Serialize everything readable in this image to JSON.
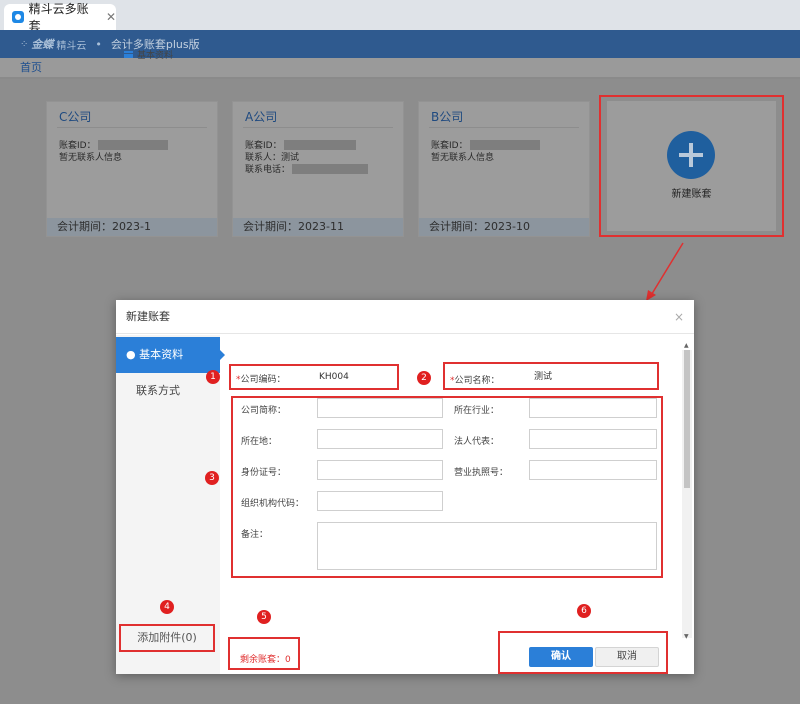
{
  "browser_tab": {
    "title": "精斗云多账套",
    "close": "✕"
  },
  "appbar": {
    "logo": "金蝶",
    "logo_sub": "精斗云",
    "separator": "•",
    "app_name": "会计多账套plus版"
  },
  "nav": {
    "home": "首页"
  },
  "cards": [
    {
      "name": "C公司",
      "rows": [
        {
          "label": "账套ID：",
          "masked": true
        },
        {
          "label": "暂无联系人信息"
        }
      ],
      "period": "会计期间：2023-1"
    },
    {
      "name": "A公司",
      "rows": [
        {
          "label": "账套ID：",
          "masked": true
        },
        {
          "label": "联系人：测试"
        },
        {
          "label": "联系电话：",
          "masked": true
        }
      ],
      "period": "会计期间：2023-11"
    },
    {
      "name": "B公司",
      "rows": [
        {
          "label": "账套ID：",
          "masked": true
        },
        {
          "label": "暂无联系人信息"
        }
      ],
      "period": "会计期间：2023-10"
    }
  ],
  "new_card": {
    "label": "新建账套"
  },
  "modal": {
    "title": "新建账套",
    "close": "×",
    "sidebar": {
      "basic": "● 基本资料",
      "contact": "联系方式"
    },
    "section_title": "基本资料",
    "fields": {
      "code": {
        "label": "公司编码：",
        "required": "*",
        "value": "KH004"
      },
      "name": {
        "label": "公司名称：",
        "required": "*",
        "value": "测试"
      },
      "short_name": {
        "label": "公司简称：",
        "value": ""
      },
      "industry": {
        "label": "所在行业：",
        "value": ""
      },
      "location": {
        "label": "所在地：",
        "value": ""
      },
      "legal_rep": {
        "label": "法人代表：",
        "value": ""
      },
      "id_number": {
        "label": "身份证号：",
        "value": ""
      },
      "license": {
        "label": "营业执照号：",
        "value": ""
      },
      "org_code": {
        "label": "组织机构代码：",
        "value": ""
      },
      "remark": {
        "label": "备注：",
        "value": ""
      }
    },
    "attach_button": "添加附件(0)",
    "remaining": "剩余账套：0",
    "confirm_button": "确认",
    "cancel_button": "取消"
  },
  "badges": [
    "1",
    "2",
    "3",
    "4",
    "5",
    "6"
  ],
  "colors": {
    "accent": "#2b7fd8",
    "annotation": "#e03030",
    "header": "#2f5a8f"
  }
}
